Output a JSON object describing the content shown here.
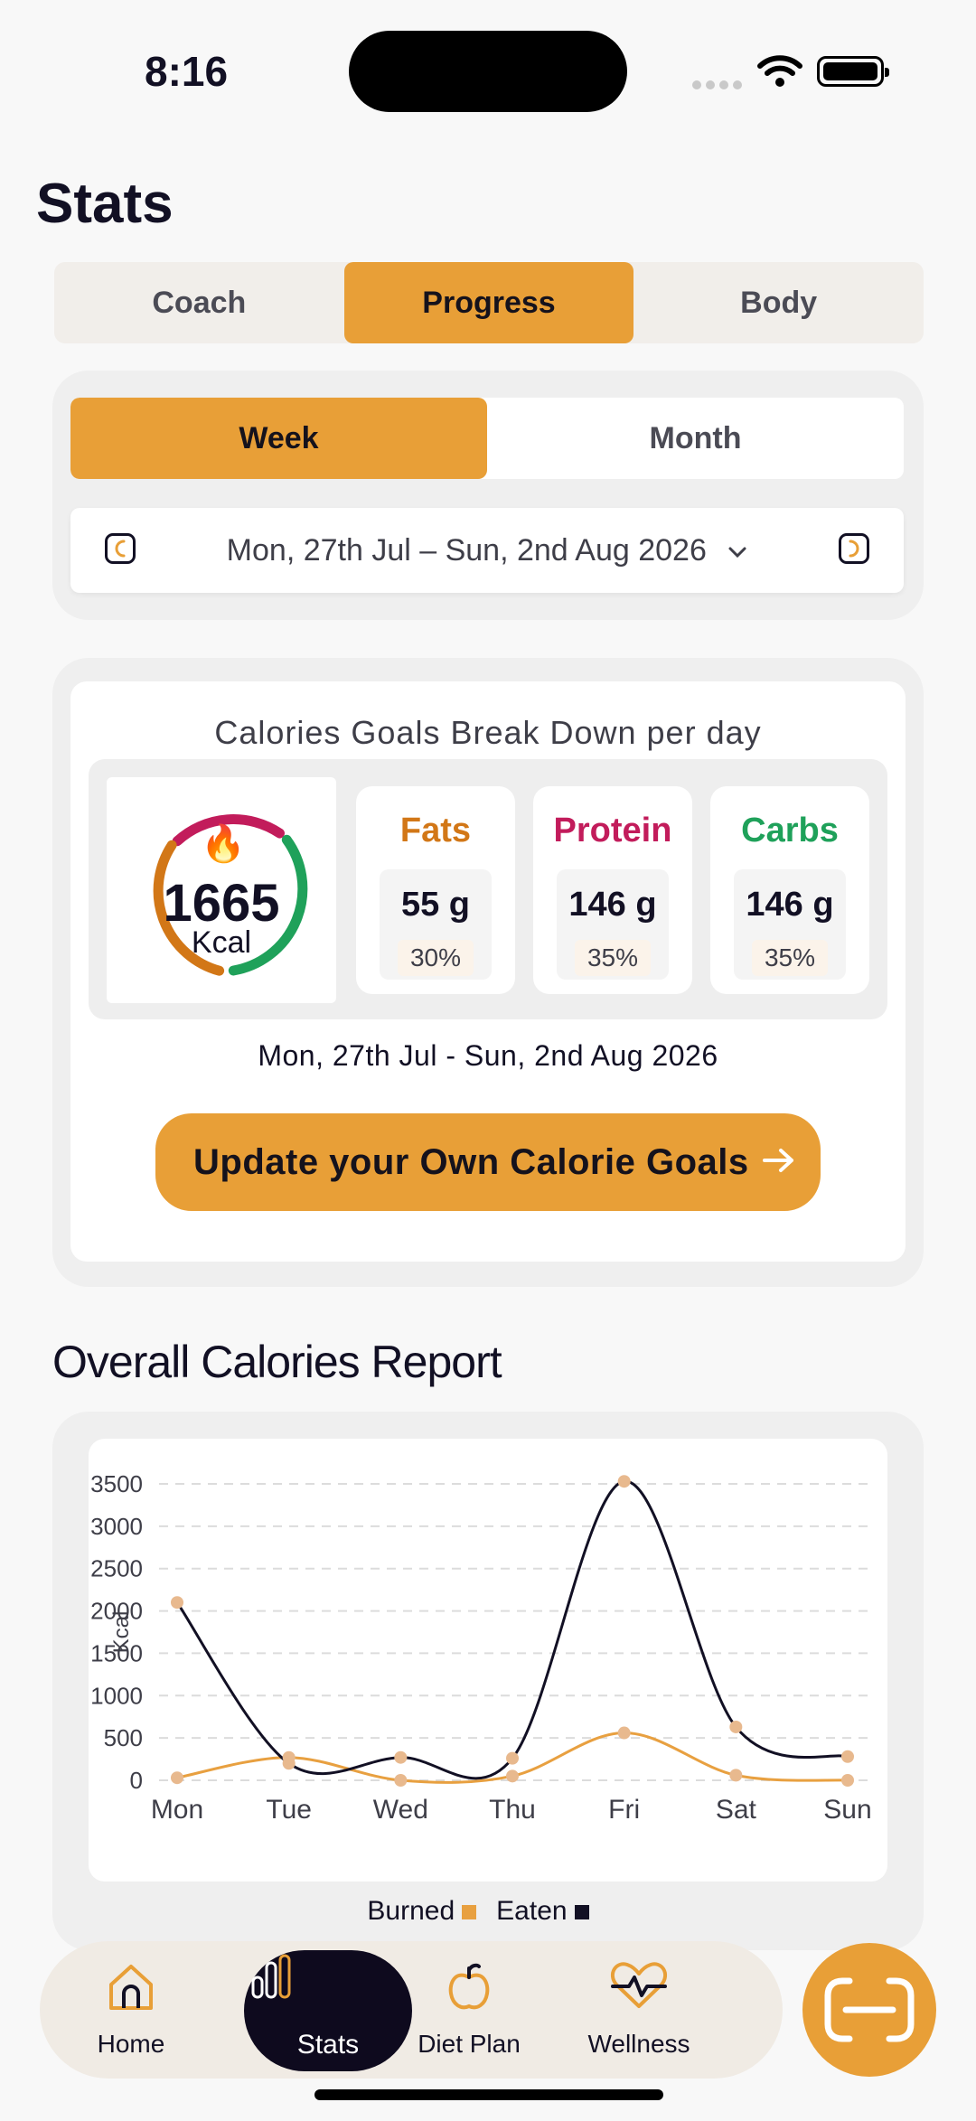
{
  "status_bar": {
    "time": "8:16"
  },
  "page": {
    "title": "Stats"
  },
  "tabs": [
    {
      "label": "Coach",
      "active": false
    },
    {
      "label": "Progress",
      "active": true
    },
    {
      "label": "Body",
      "active": false
    }
  ],
  "period": {
    "week": "Week",
    "month": "Month",
    "selected": "Week"
  },
  "date_range": {
    "text": "Mon, 27th Jul – Sun, 2nd Aug 2026"
  },
  "breakdown": {
    "title": "Calories Goals Break Down per day",
    "kcal_value": "1665",
    "kcal_unit": "Kcal",
    "macros": [
      {
        "name": "Fats",
        "amount": "55 g",
        "percent": "30%",
        "color": "#d27717"
      },
      {
        "name": "Protein",
        "amount": "146 g",
        "percent": "35%",
        "color": "#c21c5b"
      },
      {
        "name": "Carbs",
        "amount": "146 g",
        "percent": "35%",
        "color": "#1fa15a"
      }
    ],
    "range_caption": "Mon, 27th Jul - Sun, 2nd Aug 2026",
    "cta_label": "Update your Own Calorie Goals"
  },
  "report": {
    "title": "Overall Calories Report",
    "legend_burned": "Burned",
    "legend_eaten": "Eaten"
  },
  "chart_data": {
    "type": "line",
    "title": "",
    "ylabel": "Kcal",
    "xlabel": "",
    "x": [
      "Mon",
      "Tue",
      "Wed",
      "Thu",
      "Fri",
      "Sat",
      "Sun"
    ],
    "ylim": [
      0,
      3500
    ],
    "yticks": [
      0,
      500,
      1000,
      1500,
      2000,
      2500,
      3000,
      3500
    ],
    "grid": true,
    "legend_position": "bottom",
    "series": [
      {
        "name": "Burned",
        "color": "#e8a040",
        "values": [
          30,
          270,
          0,
          50,
          560,
          60,
          0
        ]
      },
      {
        "name": "Eaten",
        "color": "#121024",
        "values": [
          2100,
          200,
          270,
          260,
          3530,
          630,
          280
        ]
      }
    ]
  },
  "bottom_nav": [
    {
      "label": "Home",
      "icon": "home-icon",
      "active": false
    },
    {
      "label": "Stats",
      "icon": "stats-icon",
      "active": true
    },
    {
      "label": "Diet Plan",
      "icon": "apple-icon",
      "active": false
    },
    {
      "label": "Wellness",
      "icon": "heart-pulse-icon",
      "active": false
    }
  ],
  "fab": {
    "icon": "scan-icon"
  }
}
